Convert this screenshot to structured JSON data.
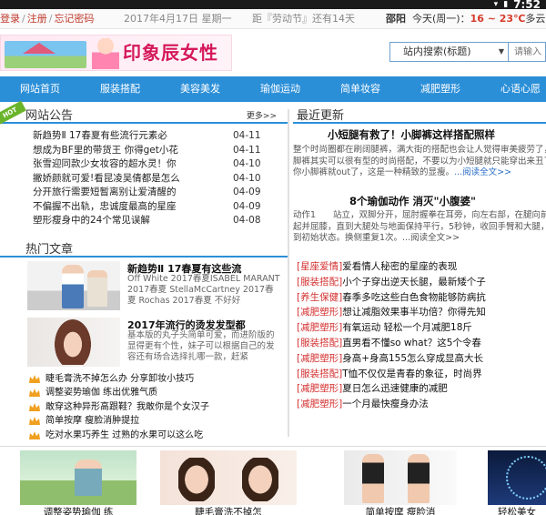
{
  "status_bar": {
    "time": "7:52"
  },
  "topbar": {
    "login": "登录",
    "register": "注册",
    "forgot": "忘记密码",
    "date": "2017年4月17日 星期一",
    "countdown": "距『劳动节』还有14天",
    "weather_city": "邵阳",
    "weather_day": "今天(周一)：",
    "weather_temp": "16 ~ 23℃",
    "weather_desc": "多云"
  },
  "header": {
    "logo_text": "印象辰女性",
    "search_select": "站内搜索(标题)",
    "search_placeholder": "请输入"
  },
  "nav": [
    "网站首页",
    "服装搭配",
    "美容美发",
    "瑜伽运动",
    "简单妆容",
    "减肥塑形",
    "心语心愿"
  ],
  "notice": {
    "title": "网站公告",
    "hot_badge": "HOT",
    "more": "更多>>",
    "items": [
      {
        "text": "新趋势Ⅱ 17春夏有些流行元素必",
        "date": "04-11"
      },
      {
        "text": "想成为BF里的带货王 你得get小花",
        "date": "04-11"
      },
      {
        "text": "张雪迎同款少女妆容的超水灵！你",
        "date": "04-10"
      },
      {
        "text": "撇娇颜就可爱!看昆凌吴倩都是怎么",
        "date": "04-10"
      },
      {
        "text": "分开旅行需要短暂离别让爱清醒的",
        "date": "04-09"
      },
      {
        "text": "不偏握不出轨，忠诚度最高的星座",
        "date": "04-09"
      },
      {
        "text": "塑形瘦身中的24个常见误解",
        "date": "04-08"
      }
    ]
  },
  "hot": {
    "title": "热门文章",
    "articles": [
      {
        "title": "新趋势Ⅱ 17春夏有这些流",
        "desc": "Off White 2017春夏ISABEL MARANT 2017春夏 StellaMcCartney 2017春夏 Rochas 2017春夏 不好好"
      },
      {
        "title": "2017年流行的烫发发型都",
        "desc": "基本版的丸子头简单可爱，而进阶版的显得更有个性，妹子可以根据自己的发容还有场合选择扎哪一款，赶紧"
      }
    ],
    "tips": [
      "睫毛膏洗不掉怎么办 分享卸妆小技巧",
      "调整姿势瑜伽 练出优雅气质",
      "敢穿这种异形高跟鞋？我敢你是个女汉子",
      "简单按摩 瘦脸消肿提拉",
      "吃对水果巧养生 过熟的水果可以这么吃"
    ]
  },
  "latest": {
    "title": "最近更新",
    "lead1": {
      "title": "小短腿有救了！小脚裤这样搭配照样",
      "summary": "整个时尚圈都在刷阔腿裤，满大街的搭配也会让人觉得审美疲劳了，小脚裤其实可以很有型的时尚搭配，不要以为小短腿就只能穿出来丑了，你小脚裤就out了，这是一种精致的显瘦。",
      "more": "...阅读全文>>"
    },
    "lead2": {
      "title": "8个瑜伽动作 消灭\"小腹婆\"",
      "summary": "动作1　　站立，双脚分开，屈肘握拳在耳旁，向左右部，在腿向前抬起并屈膝，直到大腿处与地面保持平行，5秒钟，收回手臂和大腿，回到初始状态。换侧重复1次。",
      "more": "...阅读全文>>"
    },
    "items": [
      {
        "cat": "[星座爱情]",
        "text": "爱看情人秘密的星座的表现"
      },
      {
        "cat": "[服装搭配]",
        "text": "小个子穿出逆天长腿，最新矮个子"
      },
      {
        "cat": "[养生保健]",
        "text": "春季多吃这些白色食物能够防病抗"
      },
      {
        "cat": "[减肥塑形]",
        "text": "想让减脂效果事半功倍？你得先知"
      },
      {
        "cat": "[减肥塑形]",
        "text": "有氧运动 轻松一个月减肥18斤"
      },
      {
        "cat": "[服装搭配]",
        "text": "直男看不懂so what？这5个令春"
      },
      {
        "cat": "[减肥塑形]",
        "text": "身高+身高155怎么穿成显高大长"
      },
      {
        "cat": "[服装搭配]",
        "text": "T恤不仅仅是青春的象征，时尚界"
      },
      {
        "cat": "[减肥塑形]",
        "text": "夏日怎么迅速健康的减肥"
      },
      {
        "cat": "[减肥塑形]",
        "text": "一个月最快瘦身办法"
      }
    ]
  },
  "bottom": [
    {
      "caption": "调整姿势瑜伽 练",
      "image": "yoga-photo"
    },
    {
      "caption": "睫毛膏洗不掉怎",
      "image": "makeup-photo"
    },
    {
      "caption": "简单按摩 瘦脸消",
      "image": "body-photo"
    },
    {
      "caption": "轻松美女",
      "image": "city-photo"
    }
  ],
  "colors": {
    "nav_bg": "#2b8fd8",
    "accent_red": "#d42f2f",
    "brand_pink": "#d5185a"
  }
}
